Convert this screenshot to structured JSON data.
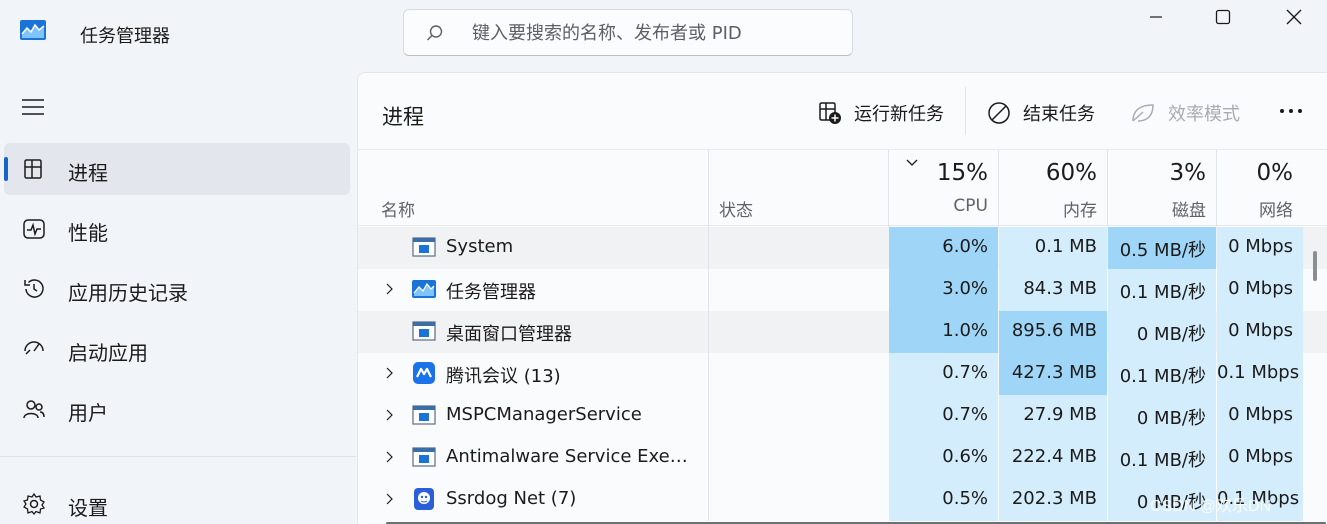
{
  "app": {
    "title": "任务管理器",
    "search_placeholder": "键入要搜索的名称、发布者或 PID"
  },
  "sidebar": {
    "items": [
      {
        "label": "进程",
        "icon": "processes-icon",
        "active": true
      },
      {
        "label": "性能",
        "icon": "performance-icon",
        "active": false
      },
      {
        "label": "应用历史记录",
        "icon": "history-icon",
        "active": false
      },
      {
        "label": "启动应用",
        "icon": "startup-icon",
        "active": false
      },
      {
        "label": "用户",
        "icon": "users-icon",
        "active": false
      }
    ],
    "settings_label": "设置"
  },
  "main": {
    "title": "进程",
    "toolbar": {
      "run_new_task": "运行新任务",
      "end_task": "结束任务",
      "efficiency_mode": "效率模式"
    }
  },
  "table": {
    "columns": {
      "name": "名称",
      "status": "状态",
      "cpu_pct": "15%",
      "cpu": "CPU",
      "mem_pct": "60%",
      "mem": "内存",
      "disk_pct": "3%",
      "disk": "磁盘",
      "net_pct": "0%",
      "net": "网络"
    },
    "rows": [
      {
        "name": "System",
        "expandable": false,
        "icon": "system-process-icon",
        "cpu": "6.0%",
        "mem": "0.1 MB",
        "disk": "0.5 MB/秒",
        "net": "0 Mbps"
      },
      {
        "name": "任务管理器",
        "expandable": true,
        "icon": "task-manager-icon",
        "cpu": "3.0%",
        "mem": "84.3 MB",
        "disk": "0.1 MB/秒",
        "net": "0 Mbps"
      },
      {
        "name": "桌面窗口管理器",
        "expandable": false,
        "icon": "system-process-icon",
        "cpu": "1.0%",
        "mem": "895.6 MB",
        "disk": "0 MB/秒",
        "net": "0 Mbps"
      },
      {
        "name": "腾讯会议 (13)",
        "expandable": true,
        "icon": "tencent-meeting-icon",
        "cpu": "0.7%",
        "mem": "427.3 MB",
        "disk": "0.1 MB/秒",
        "net": "0.1 Mbps"
      },
      {
        "name": "MSPCManagerService",
        "expandable": true,
        "icon": "system-process-icon",
        "cpu": "0.7%",
        "mem": "27.9 MB",
        "disk": "0 MB/秒",
        "net": "0 Mbps"
      },
      {
        "name": "Antimalware Service Executable",
        "expandable": true,
        "icon": "system-process-icon",
        "cpu": "0.6%",
        "mem": "222.4 MB",
        "disk": "0.1 MB/秒",
        "net": "0 Mbps"
      },
      {
        "name": "Ssrdog Net (7)",
        "expandable": true,
        "icon": "ssrdog-icon",
        "cpu": "0.5%",
        "mem": "202.3 MB",
        "disk": "0 MB/秒",
        "net": "0.1 Mbps"
      }
    ]
  },
  "watermark": "CSDN @欢乐DN",
  "colors": {
    "accent": "#1467c8",
    "heat_high": "#9fd6f7",
    "heat_mid": "#b9e1f9",
    "heat_low": "#d4edfc"
  }
}
